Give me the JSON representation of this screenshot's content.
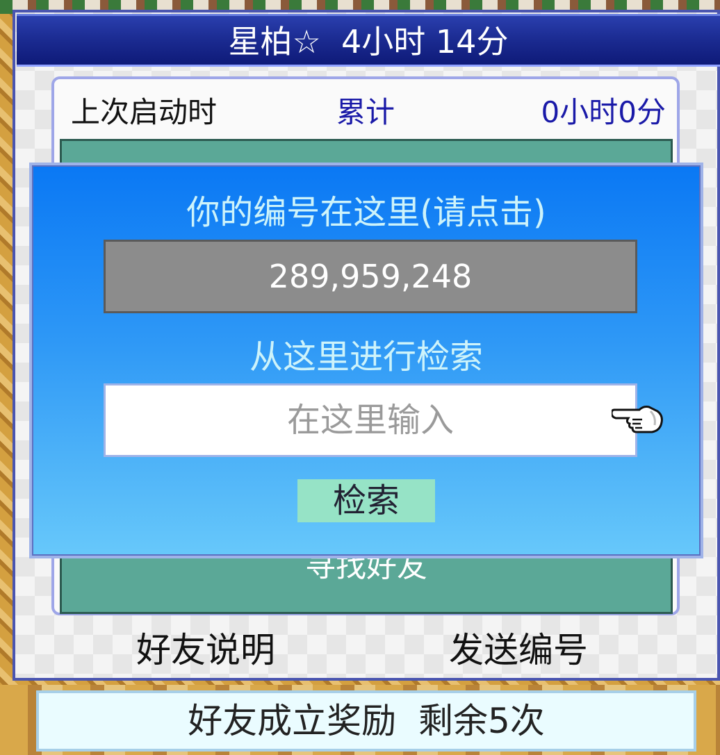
{
  "title": "星柏☆  4小时 14分",
  "stats": {
    "last_start_label": "上次启动时",
    "total_label": "累计",
    "total_value": "0小时0分"
  },
  "hidden_button_label": "寻找好友",
  "dialog": {
    "id_heading": "你的编号在这里(请点击)",
    "id_value": "289,959,248",
    "search_heading": "从这里进行检索",
    "search_placeholder": "在这里输入",
    "search_button": "检索"
  },
  "links": {
    "friend_help": "好友说明",
    "send_id": "发送编号"
  },
  "footer": {
    "reward_text": "好友成立奖励  剩余5次"
  },
  "colors": {
    "title_bar": "#1c2c93",
    "dialog_top": "#0a78f4",
    "dialog_bottom": "#67c8fa",
    "teal_panel": "#5ba897",
    "search_button": "#96e3c6",
    "accent_blue_text": "#1a1aa8"
  },
  "icons": {
    "pointer": "pointing-hand-icon"
  }
}
